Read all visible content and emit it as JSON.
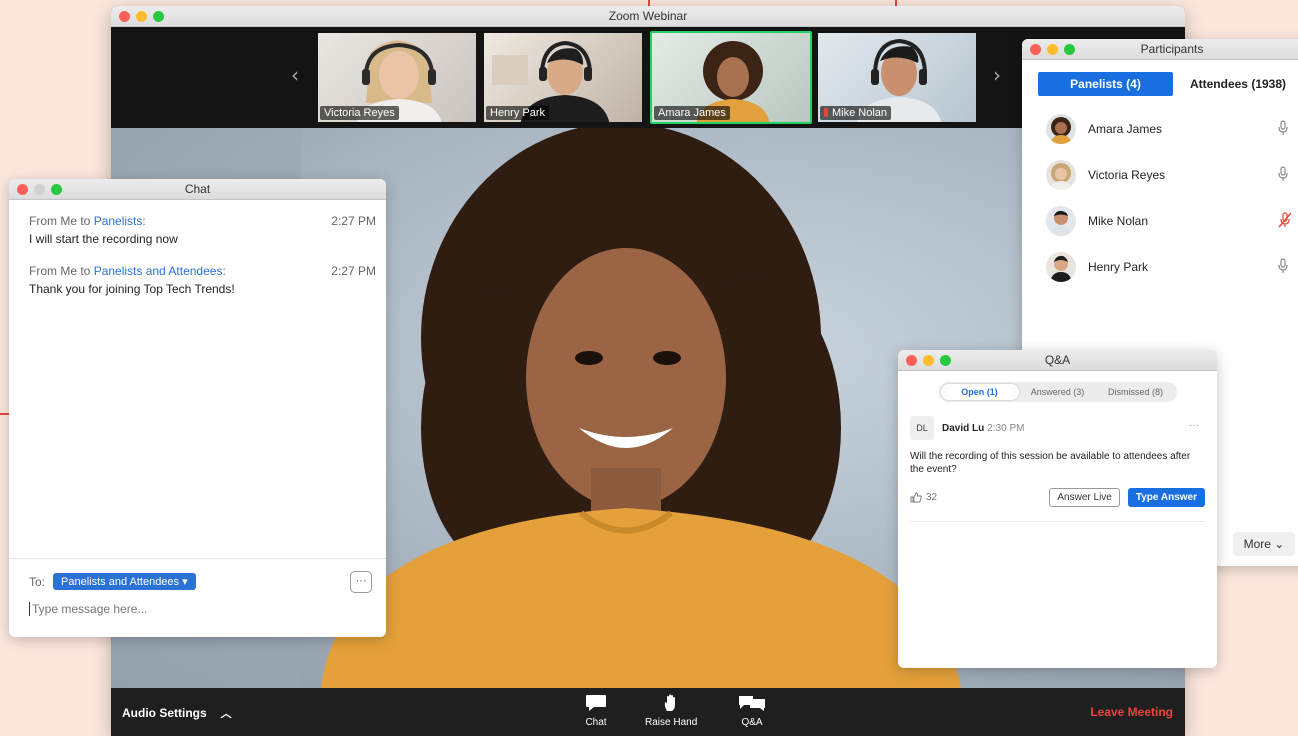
{
  "main_window": {
    "title": "Zoom Webinar",
    "gallery": [
      {
        "name": "Victoria Reyes",
        "muted": false,
        "active": false
      },
      {
        "name": "Henry Park",
        "muted": false,
        "active": false
      },
      {
        "name": "Amara James",
        "muted": false,
        "active": true
      },
      {
        "name": "Mike Nolan",
        "muted": true,
        "active": false
      }
    ],
    "prev_icon": "chevron-left-icon",
    "next_icon": "chevron-right-icon",
    "toolbar": {
      "audio_settings": "Audio Settings",
      "chat": "Chat",
      "raise_hand": "Raise Hand",
      "qa": "Q&A",
      "leave": "Leave Meeting"
    }
  },
  "chat": {
    "title": "Chat",
    "messages": [
      {
        "prefix": "From Me to ",
        "recipient": "Panelists:",
        "time": "2:27 PM",
        "text": "I will start the recording now"
      },
      {
        "prefix": "From Me to ",
        "recipient": "Panelists and Attendees:",
        "time": "2:27 PM",
        "text": "Thank you for joining Top Tech Trends!"
      }
    ],
    "to_label": "To:",
    "to_value": "Panelists and Attendees ▾",
    "more": "···",
    "placeholder": "Type message here..."
  },
  "participants": {
    "title": "Participants",
    "tabs": [
      "Panelists (4)",
      "Attendees (1938)"
    ],
    "list": [
      {
        "name": "Amara James",
        "muted": false
      },
      {
        "name": "Victoria Reyes",
        "muted": false
      },
      {
        "name": "Mike Nolan",
        "muted": true
      },
      {
        "name": "Henry Park",
        "muted": false
      }
    ],
    "more": "More ⌄"
  },
  "qa": {
    "title": "Q&A",
    "tabs": [
      "Open (1)",
      "Answered (3)",
      "Dismissed (8)"
    ],
    "item": {
      "initials": "DL",
      "author": "David Lu",
      "time": "2:30 PM",
      "menu": "···",
      "question": "Will the recording of this session be available to attendees after the event?",
      "likes": "32",
      "answer_live": "Answer Live",
      "type_answer": "Type Answer"
    }
  },
  "colors": {
    "accent_blue": "#1a6fe0",
    "leave_red": "#e8453c",
    "callout_red": "#e8453c",
    "active_tile": "#23d160",
    "page_bg": "#fbe7dc"
  }
}
